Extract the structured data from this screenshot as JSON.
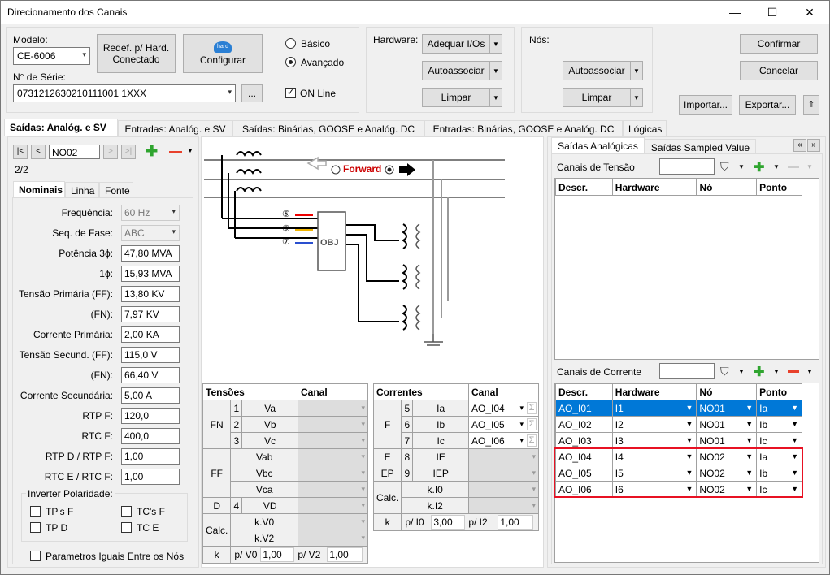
{
  "window": {
    "title": "Direcionamento dos Canais",
    "min": "—",
    "max": "☐",
    "close": "✕"
  },
  "top": {
    "modelo_label": "Modelo:",
    "modelo_value": "CE-6006",
    "redef_label": "Redef. p/ Hard. Conectado",
    "configurar_label": "Configurar",
    "configurar_icon_text": "hard",
    "serie_label": "N° de Série:",
    "serie_value": "0731212630210111001 1XXX",
    "serie_btn": "...",
    "basico": "Básico",
    "avancado": "Avançado",
    "online": "ON Line",
    "hardware_label": "Hardware:",
    "adequar": "Adequar I/Os",
    "autoassociar": "Autoassociar",
    "limpar": "Limpar",
    "nos_label": "Nós:",
    "nos_autoassociar": "Autoassociar",
    "nos_limpar": "Limpar",
    "confirmar": "Confirmar",
    "cancelar": "Cancelar",
    "importar": "Importar...",
    "exportar": "Exportar..."
  },
  "tabs": [
    "Saídas: Analóg. e SV",
    "Entradas: Analóg. e SV",
    "Saídas: Binárias, GOOSE e Analóg. DC",
    "Entradas: Binárias, GOOSE e Analóg. DC",
    "Lógicas"
  ],
  "nav": {
    "first": "|<",
    "prev": "<",
    "node": "NO02",
    "next": ">",
    "last": ">|",
    "count": "2/2"
  },
  "subtabs": [
    "Nominais",
    "Linha",
    "Fonte"
  ],
  "params": [
    {
      "label": "Frequência:",
      "value": "60 Hz",
      "type": "combo"
    },
    {
      "label": "Seq. de Fase:",
      "value": "ABC",
      "type": "combo"
    },
    {
      "label": "Potência 3ϕ:",
      "value": "47,80 MVA",
      "type": "input"
    },
    {
      "label": "1ϕ:",
      "value": "15,93 MVA",
      "type": "input"
    },
    {
      "label": "Tensão Primária (FF):",
      "value": "13,80 KV",
      "type": "input"
    },
    {
      "label": "(FN):",
      "value": "7,97 KV",
      "type": "input"
    },
    {
      "label": "Corrente Primária:",
      "value": "2,00 KA",
      "type": "input"
    },
    {
      "label": "Tensão Secund. (FF):",
      "value": "115,0 V",
      "type": "input"
    },
    {
      "label": "(FN):",
      "value": "66,40 V",
      "type": "input"
    },
    {
      "label": "Corrente Secundária:",
      "value": "5,00 A",
      "type": "input"
    },
    {
      "label": "RTP F:",
      "value": "120,0",
      "type": "input"
    },
    {
      "label": "RTC F:",
      "value": "400,0",
      "type": "input"
    },
    {
      "label": "RTP D / RTP F:",
      "value": "1,00",
      "type": "input"
    },
    {
      "label": "RTC E / RTC F:",
      "value": "1,00",
      "type": "input"
    }
  ],
  "polaridade": {
    "label": "Inverter Polaridade:",
    "tpf": "TP's F",
    "tcf": "TC's F",
    "tpd": "TP D",
    "tce": "TC E"
  },
  "param_iguais": "Parametros Iguais Entre os Nós",
  "diagram": {
    "forward": "Forward",
    "obj": "OBJ",
    "n5": "⑤",
    "n6": "⑥",
    "n7": "⑦"
  },
  "tensoes": {
    "h1": "Tensões",
    "h2": "Canal",
    "rows": [
      [
        "FN",
        "1",
        "Va"
      ],
      [
        "",
        "2",
        "Vb"
      ],
      [
        "",
        "3",
        "Vc"
      ],
      [
        "FF",
        "",
        "Vab"
      ],
      [
        "",
        "",
        "Vbc"
      ],
      [
        "",
        "",
        "Vca"
      ],
      [
        "D",
        "4",
        "VD"
      ],
      [
        "Calc.",
        "",
        "k.V0"
      ],
      [
        "",
        "",
        "k.V2"
      ]
    ],
    "k_label": "k",
    "pv0_label": "p/ V0",
    "pv0": "1,00",
    "pv2_label": "p/ V2",
    "pv2": "1,00"
  },
  "correntes": {
    "h1": "Correntes",
    "h2": "Canal",
    "rows": [
      [
        "F",
        "5",
        "Ia",
        "AO_I04"
      ],
      [
        "",
        "6",
        "Ib",
        "AO_I05"
      ],
      [
        "",
        "7",
        "Ic",
        "AO_I06"
      ],
      [
        "E",
        "8",
        "IE",
        ""
      ],
      [
        "EP",
        "9",
        "IEP",
        ""
      ],
      [
        "Calc.",
        "",
        "k.I0",
        ""
      ],
      [
        "",
        "",
        "k.I2",
        ""
      ]
    ],
    "k_label": "k",
    "pi0_label": "p/ I0",
    "pi0": "3,00",
    "pi2_label": "p/ I2",
    "pi2": "1,00"
  },
  "right_tabs": [
    "Saídas Analógicas",
    "Saídas Sampled Value"
  ],
  "tensao": {
    "label": "Canais de Tensão",
    "headers": [
      "Descr.",
      "Hardware",
      "Nó",
      "Ponto"
    ]
  },
  "corrente": {
    "label": "Canais de Corrente",
    "headers": [
      "Descr.",
      "Hardware",
      "Nó",
      "Ponto"
    ],
    "rows": [
      [
        "AO_I01",
        "I1",
        "NO01",
        "Ia"
      ],
      [
        "AO_I02",
        "I2",
        "NO01",
        "Ib"
      ],
      [
        "AO_I03",
        "I3",
        "NO01",
        "Ic"
      ],
      [
        "AO_I04",
        "I4",
        "NO02",
        "Ia"
      ],
      [
        "AO_I05",
        "I5",
        "NO02",
        "Ib"
      ],
      [
        "AO_I06",
        "I6",
        "NO02",
        "Ic"
      ]
    ]
  },
  "colors": {
    "accent": "#0078d7",
    "highlight": "#e81123",
    "plus": "#2fa52f",
    "minus": "#e8412c"
  }
}
